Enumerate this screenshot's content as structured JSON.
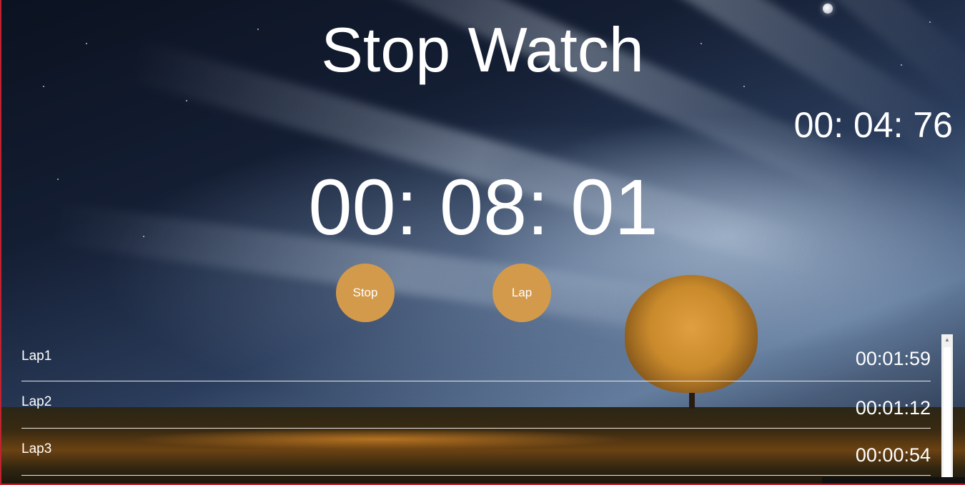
{
  "title": "Stop Watch",
  "lap_timer": "00: 04: 76",
  "main_timer": "00: 08: 01",
  "buttons": {
    "stop_label": "Stop",
    "lap_label": "Lap"
  },
  "laps": [
    {
      "name": "Lap1",
      "time": "00:01:59"
    },
    {
      "name": "Lap2",
      "time": "00:01:12"
    },
    {
      "name": "Lap3",
      "time": "00:00:54"
    }
  ],
  "colors": {
    "button": "#d39a4c",
    "text": "#ffffff",
    "divider": "#e8e8e8",
    "frame": "#c0222f"
  }
}
